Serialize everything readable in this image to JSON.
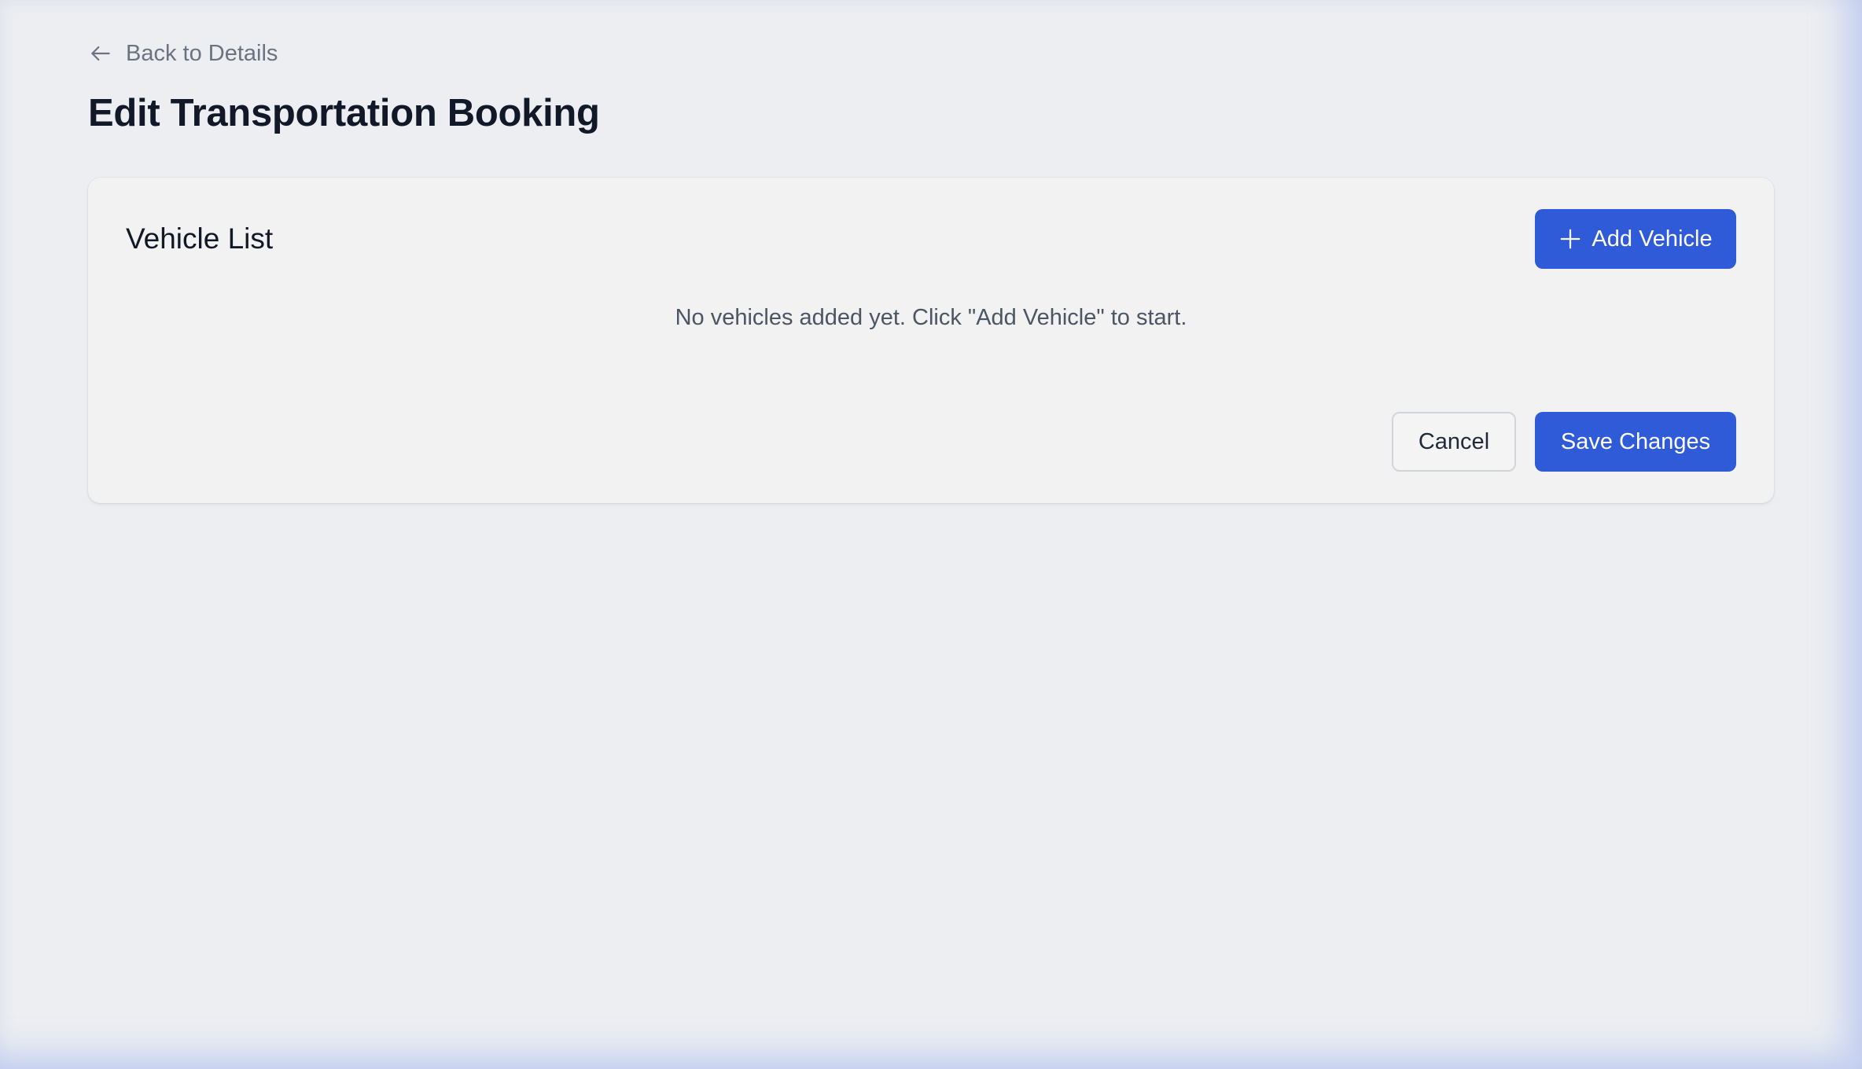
{
  "nav": {
    "back_label": "Back to Details",
    "back_icon": "arrow-left-icon"
  },
  "page": {
    "title": "Edit Transportation Booking"
  },
  "vehicle_list": {
    "title": "Vehicle List",
    "add_button_label": "Add Vehicle",
    "add_icon": "plus-icon",
    "empty_message": "No vehicles added yet. Click \"Add Vehicle\" to start."
  },
  "actions": {
    "cancel_label": "Cancel",
    "save_label": "Save Changes"
  },
  "colors": {
    "primary": "#2f5bd8",
    "background": "#eceef1",
    "card": "#f2f2f3",
    "title_text": "#111827",
    "muted_text": "#6b7280"
  }
}
